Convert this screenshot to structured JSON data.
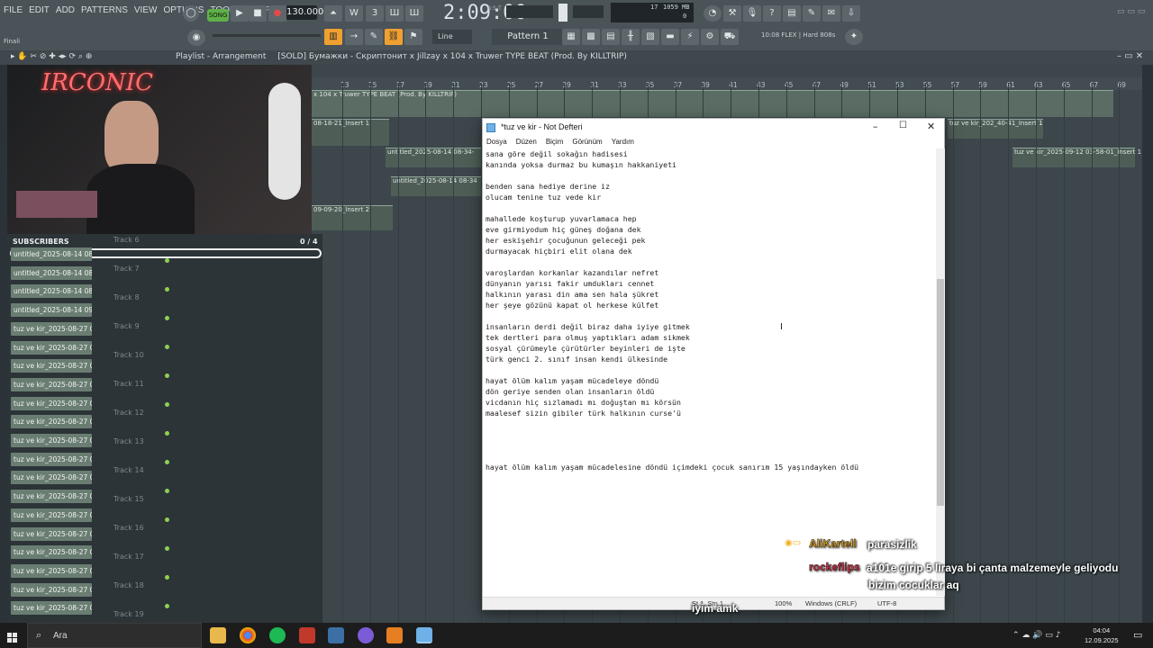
{
  "fl": {
    "menu": [
      "FILE",
      "EDIT",
      "ADD",
      "PATTERNS",
      "VIEW",
      "OPTIONS",
      "TOOLS",
      "HELP"
    ],
    "song_mode": "SONG",
    "bpm": "130.000",
    "time": "2:09:00",
    "time_unit": "B:S:T",
    "cpu_num": "17",
    "cpu_mem": "1059 MB",
    "cpu_zero": "0",
    "line_mode": "Line",
    "pattern": "Pattern 1",
    "hint": "10:08  FLEX | Hard 808s",
    "final": "Finali"
  },
  "playlist": {
    "title": "Playlist - Arrangement",
    "project": "[SOLD] Бумажки - Скриптонит x Jillzay x 104 x Truwer TYPE BEAT (Prod. By KILLTRIP)",
    "ruler": [
      "13",
      "15",
      "17",
      "19",
      "21",
      "23",
      "25",
      "27",
      "29",
      "31",
      "33",
      "35",
      "37",
      "39",
      "41",
      "43",
      "45",
      "47",
      "49",
      "51",
      "53",
      "55",
      "57",
      "59",
      "61",
      "63",
      "65",
      "67",
      "69"
    ],
    "clips": [
      "x 104 x Truwer TYPE BEAT (Prod. By KILLTRIP)",
      "08-18-21_Insert 1",
      "untitled_2025-08-14 08-34-",
      "untitled_2025-08-14 08-34",
      "09-09-20_Insert 2",
      "tuz ve kir_202_40-41_Insert 1",
      "tuz ve kir_2025-09-12 03-58-01_Insert 1"
    ]
  },
  "sidebar": {
    "subs_label": "SUBSCRIBERS",
    "subs_count": "0 / 4",
    "subs_progress": 0.0,
    "items": [
      "untitled_2025-08-14 08-",
      "untitled_2025-08-14 08-",
      "untitled_2025-08-14 08-",
      "untitled_2025-08-14 09-",
      "tuz ve kir_2025-08-27 08.",
      "tuz ve kir_2025-08-27 08.",
      "tuz ve kir_2025-08-27 08.",
      "tuz ve kir_2025-08-27 08.",
      "tuz ve kir_2025-08-27 08.",
      "tuz ve kir_2025-08-27 08.",
      "tuz ve kir_2025-08-27 08.",
      "tuz ve kir_2025-08-27 08.",
      "tuz ve kir_2025-08-27 08.",
      "tuz ve kir_2025-08-27 08.",
      "tuz ve kir_2025-08-27 08.",
      "tuz ve kir_2025-08-27 08.",
      "tuz ve kir_2025-08-27 08.",
      "tuz ve kir_2025-08-27 08.",
      "tuz ve kir_2025-08-27 08.",
      "tuz ve kir_2025-08-27 08."
    ],
    "tracks": [
      "Track 6",
      "Track 7",
      "Track 8",
      "Track 9",
      "Track 10",
      "Track 11",
      "Track 12",
      "Track 13",
      "Track 14",
      "Track 15",
      "Track 16",
      "Track 17",
      "Track 18",
      "Track 19"
    ]
  },
  "webcam": {
    "neon": "IRCONIC"
  },
  "notepad": {
    "title": "*tuz ve kir - Not Defteri",
    "menu": [
      "Dosya",
      "Düzen",
      "Biçim",
      "Görünüm",
      "Yardım"
    ],
    "text": "sana göre değil sokağın hadisesi\nkanında yoksa durmaz bu kumaşın hakkaniyeti\n\nbenden sana hediye derine iz\nolucam tenine tuz vede kir\n\nmahallede koşturup yuvarlamaca hep\neve girmiyodum hiç güneş doğana dek\nher eskişehir çocuğunun geleceği pek\ndurmayacak hiçbiri elit olana dek\n\nvaroşlardan korkanlar kazandılar nefret\ndünyanın yarısı fakir umdukları cennet\nhalkının yarası din ama sen hala şükret\nher şeye gözünü kapat ol herkese külfet\n\ninsanların derdi değil biraz daha iyiye gitmek\ntek dertleri para olmuş yaptıkları adam sikmek\nsosyal çürümeyle çürütürler beyinleri de işte\ntürk genci 2. sınıf insan kendi ülkesinde\n\nhayat ölüm kalım yaşam mücadeleye döndü\ndön geriye senden olan insanların öldü\nvicdanın hiç sızlamadı mı doğuştan mı körsün\nmaalesef sizin gibiler türk halkının curse'ü\n\n\n\n\nhayat ölüm kalım yaşam mücadelesine döndü içimdeki çocuk sanırım 15 yaşındayken öldü",
    "status_pos": "St 1, Stn 1",
    "status_zoom": "100%",
    "status_eol": "Windows (CRLF)",
    "status_enc": "UTF-8"
  },
  "chat": [
    {
      "name": "AliKartell",
      "msg": "parasizlik",
      "color": "#f0b020"
    },
    {
      "name": "rockeflips",
      "msg": "a101e girip 5 liraya bi çanta malzemeyle geliyodu",
      "color": "#e0304a"
    },
    {
      "name": "",
      "msg": "bizim cocuklar aq",
      "color": "#ffffff"
    },
    {
      "name": "",
      "msg": "iyim amk",
      "color": "#ffffff"
    }
  ],
  "taskbar": {
    "search": "Ara",
    "time": "04:04",
    "date": "12.09.2025"
  }
}
